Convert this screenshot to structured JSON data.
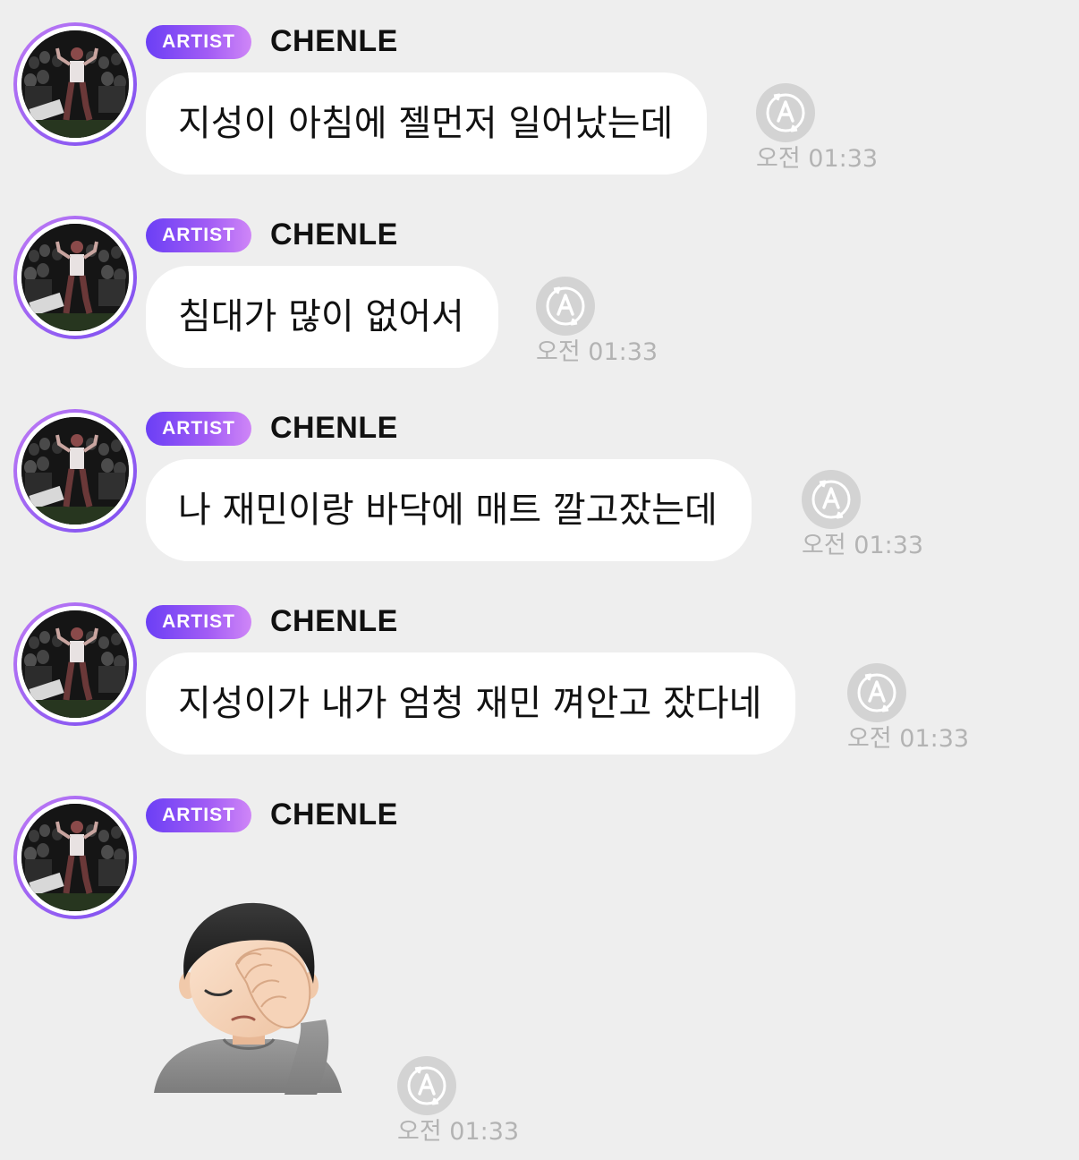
{
  "messages": [
    {
      "badge": "ARTIST",
      "sender": "CHENLE",
      "text": "지성이 아침에 젤먼저 일어났는데",
      "time": "오전 01:33"
    },
    {
      "badge": "ARTIST",
      "sender": "CHENLE",
      "text": "침대가 많이 없어서",
      "time": "오전 01:33"
    },
    {
      "badge": "ARTIST",
      "sender": "CHENLE",
      "text": "나 재민이랑 바닥에 매트 깔고잤는데",
      "time": "오전 01:33"
    },
    {
      "badge": "ARTIST",
      "sender": "CHENLE",
      "text": "지성이가 내가 엄청 재민 껴안고 잤다네",
      "time": "오전 01:33"
    },
    {
      "badge": "ARTIST",
      "sender": "CHENLE",
      "sticker": "face-palm-emoji",
      "time": "오전 01:33"
    }
  ],
  "icons": {
    "translate": "translate-icon",
    "avatar": "artist-avatar"
  },
  "colors": {
    "background": "#eeeeee",
    "bubble": "#ffffff",
    "badge_start": "#6b3ff5",
    "badge_end": "#cf86f7",
    "timestamp": "#b3b3b3",
    "translate_button": "#d3d3d3"
  }
}
